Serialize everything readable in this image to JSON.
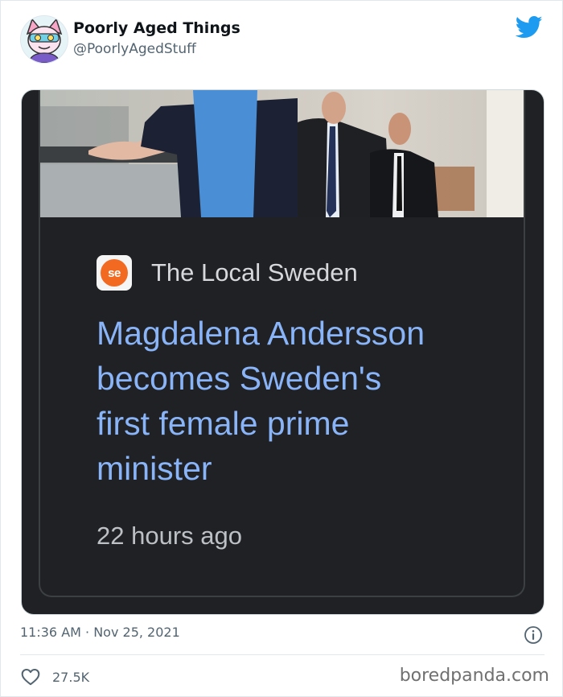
{
  "tweet": {
    "display_name": "Poorly Aged Things",
    "handle": "@PoorlyAgedStuff",
    "timestamp": "11:36 AM · Nov 25, 2021",
    "like_count": "27.5K"
  },
  "card": {
    "source_logo_text": "se",
    "source_name": "The Local Sweden",
    "headline_lines": [
      "Magdalena Andersson",
      "becomes Sweden's",
      "first female prime",
      "minister"
    ],
    "age": "22 hours ago"
  },
  "watermark": "boredpanda.com",
  "icons": {
    "brand": "twitter-bird-icon",
    "info": "info-icon",
    "like": "heart-icon"
  },
  "colors": {
    "twitter_blue": "#1d9bf0",
    "card_background": "#202124",
    "headline_link": "#8ab4f8",
    "source_logo": "#f26a21"
  }
}
